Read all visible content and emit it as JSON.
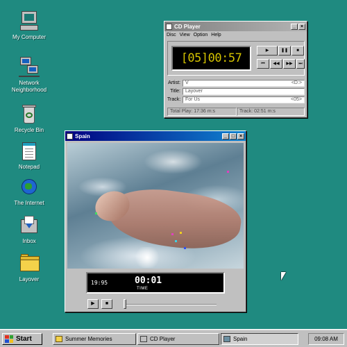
{
  "desktop": {
    "icons": [
      {
        "label": "My Computer"
      },
      {
        "label": "Network Neighborhood"
      },
      {
        "label": "Recycle Bin"
      },
      {
        "label": "Notepad"
      },
      {
        "label": "The Internet"
      },
      {
        "label": "Inbox"
      },
      {
        "label": "Layover"
      }
    ]
  },
  "cd_player": {
    "title": "CD Player",
    "menu": [
      "Disc",
      "View",
      "Option",
      "Help"
    ],
    "display": "[05]00:57",
    "buttons": {
      "play": "▶",
      "pause": "❚❚",
      "stop": "■",
      "prev_track": "⏮",
      "rewind": "◀◀",
      "forward": "▶▶",
      "next_track": "⏭"
    },
    "artist_label": "Artist:",
    "artist_value": "V",
    "artist_drive": "<D:>",
    "title_label": "Title:",
    "title_value": "Layover",
    "track_label": "Track:",
    "track_value": "For Us",
    "track_number": "<05>",
    "total_play": "Total Play: 17:36 m:s",
    "track_time": "Track: 02:51 m:s"
  },
  "spain": {
    "title": "Spain",
    "position": "19:95",
    "time": "00:01",
    "time_label": "TIME",
    "buttons": {
      "play": "▶",
      "stop": "■"
    }
  },
  "taskbar": {
    "start_label": "Start",
    "tasks": [
      {
        "label": "Summer Memories"
      },
      {
        "label": "CD Player"
      },
      {
        "label": "Spain"
      }
    ],
    "clock": "09:08 AM"
  },
  "colors": {
    "desktop": "#1f8a80",
    "title_active": "#000080",
    "title_inactive": "#808080",
    "lcd_text": "#d4c200"
  }
}
